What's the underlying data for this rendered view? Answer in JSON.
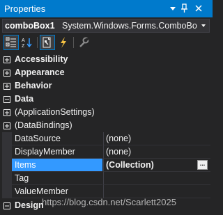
{
  "window": {
    "title": "Properties",
    "buttons": {
      "dropdown": "▾",
      "pin": "📌",
      "close": "✕"
    }
  },
  "object_selector": {
    "name": "comboBox1",
    "type": "System.Windows.Forms.ComboBo",
    "dropdown_icon": "triangle-down-icon"
  },
  "toolbar": {
    "items": [
      {
        "name": "categorized-icon",
        "active": true
      },
      {
        "name": "alphabetical-icon",
        "active": false
      },
      {
        "name": "properties-icon",
        "active": true
      },
      {
        "name": "events-icon",
        "active": false
      },
      {
        "name": "property-pages-icon",
        "active": false
      }
    ]
  },
  "grid": {
    "rows": [
      {
        "kind": "category",
        "label": "Accessibility",
        "expanded": false
      },
      {
        "kind": "category",
        "label": "Appearance",
        "expanded": false
      },
      {
        "kind": "category",
        "label": "Behavior",
        "expanded": false
      },
      {
        "kind": "category",
        "label": "Data",
        "expanded": true
      },
      {
        "kind": "subcategory",
        "label": "(ApplicationSettings)",
        "expanded": false
      },
      {
        "kind": "subcategory",
        "label": "(DataBindings)",
        "expanded": false
      },
      {
        "kind": "property",
        "label": "DataSource",
        "value": "(none)"
      },
      {
        "kind": "property",
        "label": "DisplayMember",
        "value": "(none)"
      },
      {
        "kind": "property",
        "label": "Items",
        "value": "(Collection)",
        "selected": true,
        "bold": true,
        "button": "..."
      },
      {
        "kind": "property",
        "label": "Tag",
        "value": ""
      },
      {
        "kind": "property",
        "label": "ValueMember",
        "value": ""
      },
      {
        "kind": "category",
        "label": "Design",
        "expanded": false
      }
    ]
  },
  "watermark": "https://blog.csdn.net/Scarlett2025",
  "colors": {
    "accent": "#007acc",
    "selection": "#3399ff",
    "background": "#252526"
  }
}
